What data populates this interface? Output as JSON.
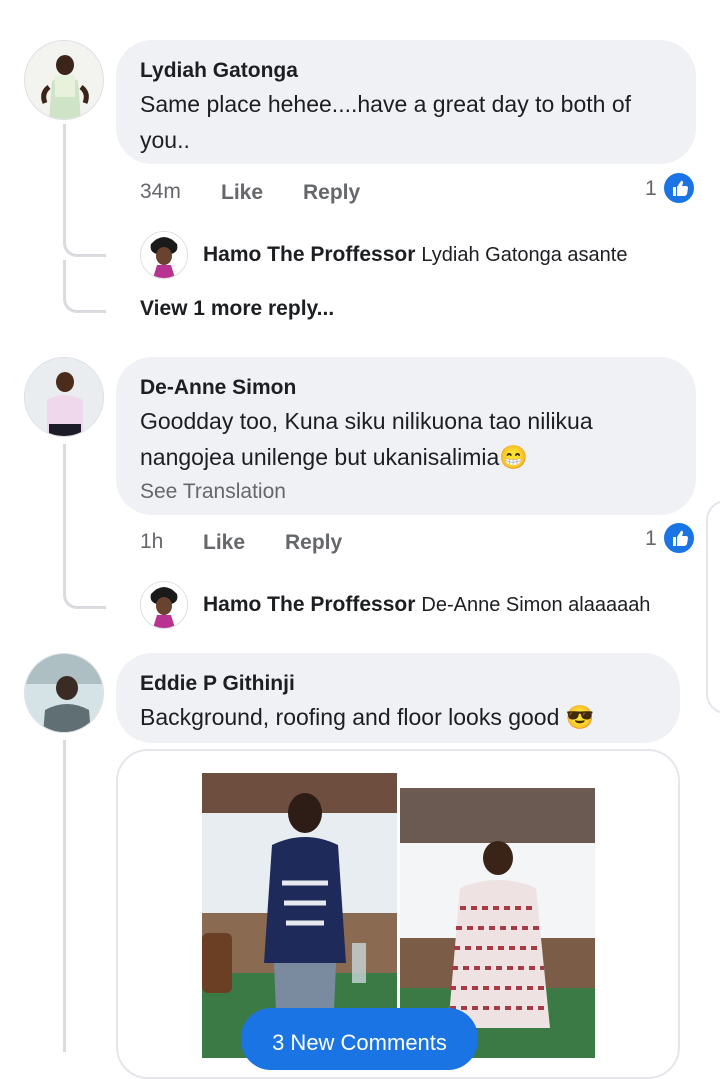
{
  "comments": [
    {
      "author": "Lydiah Gatonga",
      "text": "Same place hehee....have a great day to both of you..",
      "time": "34m",
      "like_label": "Like",
      "reply_label": "Reply",
      "like_count": "1",
      "replies": [
        {
          "author": "Hamo The Proffessor",
          "text": "Lydiah Gatonga asante"
        }
      ],
      "view_more": "View 1 more reply..."
    },
    {
      "author": "De-Anne Simon",
      "text_line1": "Goodday too, Kuna siku nilikuona tao nilikua",
      "text_line2": "nangojea unilenge but ukanisalimia",
      "emoji": "😁",
      "see_translation": "See Translation",
      "time": "1h",
      "like_label": "Like",
      "reply_label": "Reply",
      "like_count": "1",
      "replies": [
        {
          "author": "Hamo The Proffessor",
          "text": "De-Anne Simon alaaaaah"
        }
      ]
    },
    {
      "author": "Eddie P Githinji",
      "text": "Background,  roofing and floor looks good",
      "emoji": "😎"
    }
  ],
  "new_comments_button": "3 New Comments",
  "colors": {
    "accent": "#1b74e4",
    "bubble": "#eff1f4",
    "thread_line": "#d9dbdf",
    "secondary_text": "#65676b"
  },
  "icons": {
    "like": "thumbs-up-icon"
  }
}
